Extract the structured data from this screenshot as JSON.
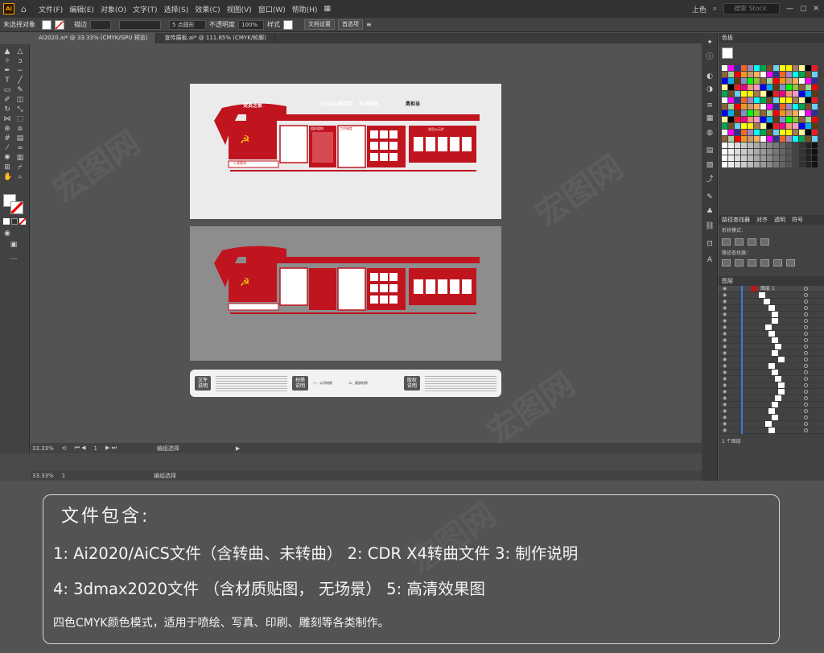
{
  "menubar": {
    "items": [
      "文件(F)",
      "编辑(E)",
      "对象(O)",
      "文字(T)",
      "选择(S)",
      "效果(C)",
      "视图(V)",
      "窗口(W)",
      "帮助(H)"
    ],
    "workspace": "上色",
    "search_placeholder": "搜索 Stock"
  },
  "control": {
    "selection_label": "未选择对象",
    "stroke_label": "描边",
    "brush_label": "5 点圆形",
    "opacity_label": "不透明度",
    "opacity_value": "100%",
    "style_label": "样式",
    "doc_setup": "文档设置",
    "prefs": "首选项"
  },
  "tabs": [
    "Ai2020.ai* @ 33.33% (CMYK/GPU 预览)",
    "宣传展板.ai* @ 111.85% (CMYK/轮廓)"
  ],
  "artboard_sign": {
    "title_left": "党员之家",
    "slogans": [
      "不忘初心跟党走",
      "牢记使命",
      "勇担当"
    ],
    "sections": [
      "入党誓词",
      "组织架构",
      "工作制度",
      "党员公示栏"
    ]
  },
  "explain_box": {
    "labels": [
      "文件说明",
      "材质说明",
      "版权说明"
    ],
    "mid_headers": [
      "一、公司材质",
      "二、画质材质"
    ]
  },
  "status": {
    "zoom": "33.33%",
    "page": "1",
    "tool": "编组选择"
  },
  "panels": {
    "swatches_title": "色板",
    "pathfinder_tabs": [
      "路径查找器",
      "对齐",
      "透明",
      "符号"
    ],
    "shape_modes": "形状模式：",
    "pathfinders": "路径查找器：",
    "layers_title": "图层",
    "layer_name": "图层 1",
    "layers_count": "1 个图层"
  },
  "info": {
    "heading": "文件包含:",
    "line1": "1: Ai2020/AiCS文件（含转曲、未转曲） 2: CDR X4转曲文件   3: 制作说明",
    "line2": "4: 3dmax2020文件 （含材质贴图， 无场景）   5: 高清效果图",
    "line3": "四色CMYK颜色模式，适用于喷绘、写真、印刷、雕刻等各类制作。"
  },
  "colors": {
    "accent": "#c0141e",
    "brand": "#ff9a00"
  }
}
